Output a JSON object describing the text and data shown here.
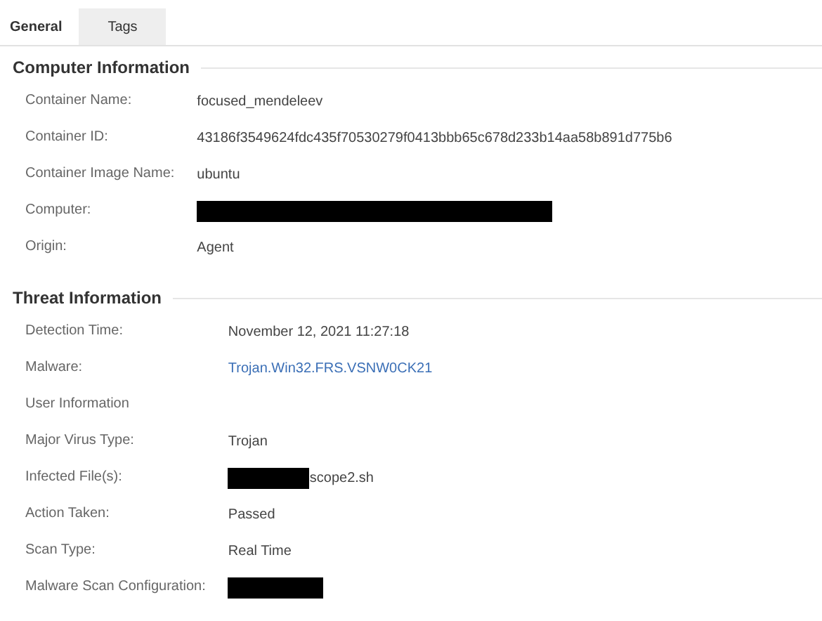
{
  "tabs": [
    {
      "label": "General",
      "selected": true
    },
    {
      "label": "Tags",
      "selected": false
    }
  ],
  "sections": [
    {
      "title": "Computer Information",
      "rows": [
        {
          "label": "Container Name:",
          "kind": "text",
          "value": "focused_mendeleev"
        },
        {
          "label": "Container ID:",
          "kind": "text",
          "value": "43186f3549624fdc435f70530279f0413bbb65c678d233b14aa58b891d775b6"
        },
        {
          "label": "Container Image Name:",
          "kind": "text",
          "value": "ubuntu"
        },
        {
          "label": "Computer:",
          "kind": "redacted_wide"
        },
        {
          "label": "Origin:",
          "kind": "text",
          "value": "Agent"
        }
      ]
    },
    {
      "title": "Threat Information",
      "rows": [
        {
          "label": "Detection Time:",
          "kind": "text",
          "value": "November 12, 2021 11:27:18"
        },
        {
          "label": "Malware:",
          "kind": "link",
          "value": "Trojan.Win32.FRS.VSNW0CK21"
        },
        {
          "label": "User Information",
          "kind": "empty"
        },
        {
          "label": "Major Virus Type:",
          "kind": "text",
          "value": "Trojan"
        },
        {
          "label": "Infected File(s):",
          "kind": "partly_redacted",
          "value": "scope2.sh"
        },
        {
          "label": "Action Taken:",
          "kind": "text",
          "value": "Passed"
        },
        {
          "label": "Scan Type:",
          "kind": "text",
          "value": "Real Time"
        },
        {
          "label": "Malware Scan Configuration:",
          "kind": "redacted"
        }
      ]
    }
  ]
}
